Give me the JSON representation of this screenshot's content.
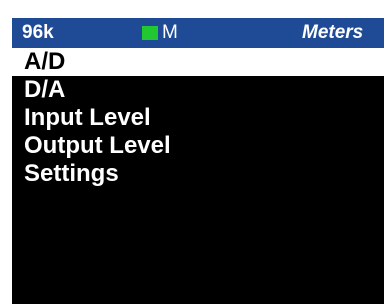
{
  "status_bar": {
    "sample_rate": "96k",
    "lock_indicator_color": "#22c832",
    "mode": "M",
    "screen_title": "Meters"
  },
  "menu": {
    "items": [
      {
        "label": "A/D",
        "selected": true
      },
      {
        "label": "D/A",
        "selected": false
      },
      {
        "label": "Input Level",
        "selected": false
      },
      {
        "label": "Output Level",
        "selected": false
      },
      {
        "label": "Settings",
        "selected": false
      }
    ]
  },
  "colors": {
    "status_bar_bg": "#1f4b96",
    "screen_bg": "#000000",
    "selected_bg": "#ffffff"
  }
}
